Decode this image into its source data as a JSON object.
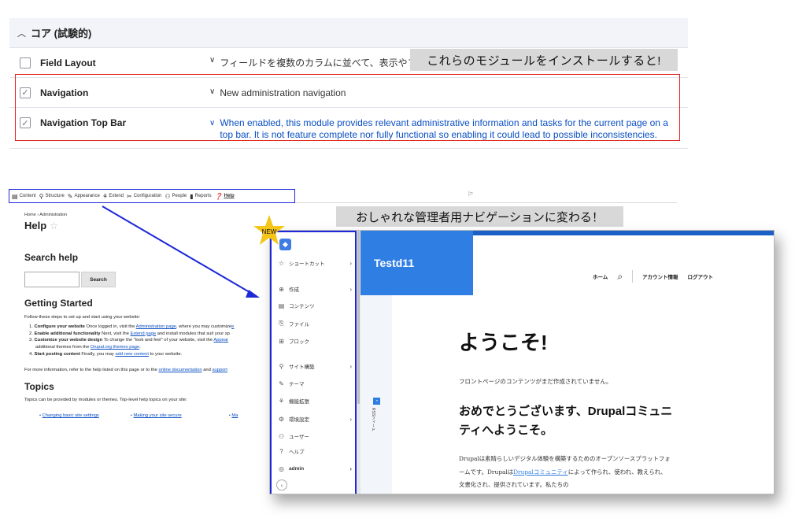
{
  "module_table": {
    "group_label": "コア (試験的)",
    "rows": [
      {
        "name": "Field Layout",
        "description": "フィールドを複数のカラムに並べて、表示やフ",
        "checked": false,
        "highlight": false
      },
      {
        "name": "Navigation",
        "description": "New administration navigation",
        "checked": true,
        "highlight": false
      },
      {
        "name": "Navigation Top Bar",
        "description": "When enabled, this module provides relevant administrative information and tasks for the current page on a top bar. It is not feature complete nor fully functional so enabling it could lead to possible inconsistencies.",
        "checked": true,
        "highlight": true
      }
    ],
    "checkbox_mark": "✓",
    "callout": "これらのモジュールをインストールすると!"
  },
  "admin_screen": {
    "toolbar": [
      {
        "icon": "content-icon",
        "label": "Content"
      },
      {
        "icon": "structure-icon",
        "label": "Structure"
      },
      {
        "icon": "appearance-icon",
        "label": "Appearance"
      },
      {
        "icon": "extend-icon",
        "label": "Extend"
      },
      {
        "icon": "configuration-icon",
        "label": "Configuration"
      },
      {
        "icon": "people-icon",
        "label": "People"
      },
      {
        "icon": "reports-icon",
        "label": "Reports"
      },
      {
        "icon": "help-icon",
        "label": "Help"
      }
    ],
    "breadcrumb": "Home  ›  Administration",
    "page_title": "Help",
    "search_heading": "Search help",
    "search_button": "Search",
    "getting_started_heading": "Getting Started",
    "getting_started_intro": "Follow these steps to set up and start using your website:",
    "steps": [
      {
        "num": "1.",
        "strong": "Configure your website",
        "text": " Once logged in, visit the ",
        "link": "Administration page",
        "tail": ", where you may customize"
      },
      {
        "num": "2.",
        "strong": "Enable additional functionality",
        "text": " Next, visit the ",
        "link": "Extend page",
        "tail": " and install modules that suit your sp"
      },
      {
        "num": "3.",
        "strong": "Customize your website design",
        "text": " To change the \"look and feel\" of your website, visit the ",
        "link": "Appear",
        "tail": ""
      },
      {
        "num": "",
        "strong": "",
        "text": "additional themes from the ",
        "link": "Drupal.org themes page",
        "tail": "."
      },
      {
        "num": "4.",
        "strong": "Start posting content",
        "text": " Finally, you may ",
        "link": "add new content",
        "tail": " to your website."
      }
    ],
    "more_info": {
      "text": "For more information, refer to the help listed on this page or to the ",
      "link1": "online documentation",
      "mid": " and ",
      "link2": "support"
    },
    "topics_heading": "Topics",
    "topics_desc": "Topics can be provided by modules or themes. Top-level help topics on your site:",
    "topics": [
      "Changing basic site settings",
      "Making your site secure",
      "Ma"
    ],
    "callout": "おしゃれな管理者用ナビゲーションに変わる！",
    "new_badge": "NEW"
  },
  "nav_sidebar": {
    "items": [
      {
        "icon": "star-icon",
        "label": "ショートカット",
        "arrow": true
      },
      {
        "icon": "plus-circle-icon",
        "label": "作成",
        "arrow": true
      },
      {
        "icon": "content-icon",
        "label": "コンテンツ",
        "arrow": false
      },
      {
        "icon": "file-icon",
        "label": "ファイル",
        "arrow": false
      },
      {
        "icon": "block-icon",
        "label": "ブロック",
        "arrow": false
      },
      {
        "icon": "structure-icon",
        "label": "サイト構築",
        "arrow": true
      },
      {
        "icon": "theme-icon",
        "label": "テーマ",
        "arrow": false
      },
      {
        "icon": "extend-icon",
        "label": "機能拡張",
        "arrow": false
      },
      {
        "icon": "config-icon",
        "label": "環境設定",
        "arrow": true
      },
      {
        "icon": "people-icon",
        "label": "ユーザー",
        "arrow": false
      },
      {
        "icon": "help-icon",
        "label": "ヘルプ",
        "arrow": false
      },
      {
        "icon": "user-icon",
        "label": "admin",
        "arrow": true
      }
    ],
    "collapse_icon": "‹"
  },
  "front_site": {
    "site_name": "Testd11",
    "nav": [
      "ホーム",
      "アカウント情報",
      "ログアウト"
    ],
    "rss_label": "RSSフィード",
    "welcome": "ようこそ!",
    "no_content": "フロントページのコンテンツがまだ作成されていません。",
    "congrats": "おめでとうございます、Drupalコミュニティへようこそ。",
    "about_1": "Drupalは素晴らしいデジタル体験を構築するためのオープンソースプラットフォームです。Drupalは",
    "about_link": "Drupalコミュニティ",
    "about_2": "によって作られ、使われ、教えられ、文書化され、提供されています。私たちの"
  },
  "colors": {
    "highlight_red": "#e0211c",
    "nav_blue": "#1d29d8",
    "brand_blue": "#2f7ee4",
    "star": "#f5c518"
  }
}
